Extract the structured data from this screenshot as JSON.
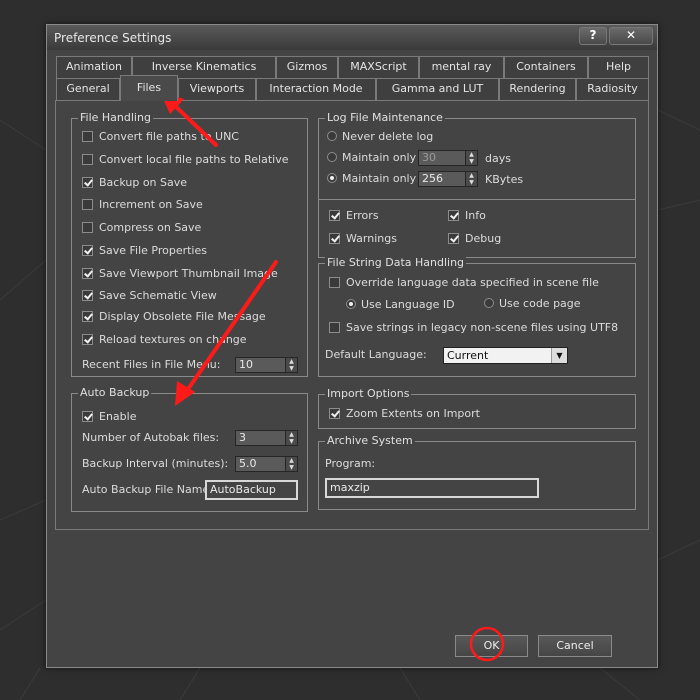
{
  "dialog": {
    "title": "Preference Settings",
    "help_label": "?",
    "close_label": "✕"
  },
  "tabs_row1": [
    "Animation",
    "Inverse Kinematics",
    "Gizmos",
    "MAXScript",
    "mental ray",
    "Containers",
    "Help"
  ],
  "tabs_row2": [
    "General",
    "Files",
    "Viewports",
    "Interaction Mode",
    "Gamma and LUT",
    "Rendering",
    "Radiosity"
  ],
  "active_tab": "Files",
  "file_handling": {
    "title": "File Handling",
    "items": [
      {
        "label": "Convert file paths to UNC",
        "checked": false
      },
      {
        "label": "Convert local file paths to Relative",
        "checked": false
      },
      {
        "label": "Backup on Save",
        "checked": true
      },
      {
        "label": "Increment on Save",
        "checked": false
      },
      {
        "label": "Compress on Save",
        "checked": false
      },
      {
        "label": "Save File Properties",
        "checked": true
      },
      {
        "label": "Save Viewport Thumbnail Image",
        "checked": true
      },
      {
        "label": "Save Schematic View",
        "checked": true
      },
      {
        "label": "Display Obsolete File Message",
        "checked": true
      },
      {
        "label": "Reload textures on change",
        "checked": true
      }
    ],
    "recent_label": "Recent Files in File Menu:",
    "recent_value": "10"
  },
  "auto_backup": {
    "title": "Auto Backup",
    "enable_label": "Enable",
    "enable_checked": true,
    "num_label": "Number of Autobak files:",
    "num_value": "3",
    "interval_label": "Backup Interval (minutes):",
    "interval_value": "5.0",
    "name_label": "Auto Backup File Name:",
    "name_value": "AutoBackup"
  },
  "log": {
    "title": "Log File Maintenance",
    "never_label": "Never delete log",
    "days_radio_label": "Maintain only",
    "days_value": "30",
    "days_unit": "days",
    "kb_radio_label": "Maintain only",
    "kb_value": "256",
    "kb_unit": "KBytes",
    "errors_label": "Errors",
    "info_label": "Info",
    "warnings_label": "Warnings",
    "debug_label": "Debug"
  },
  "file_string": {
    "title": "File String Data Handling",
    "override_label": "Override language data specified in scene file",
    "use_lang_label": "Use Language ID",
    "use_code_label": "Use code page",
    "save_strings_label": "Save strings in legacy non-scene files using UTF8",
    "default_lang_label": "Default Language:",
    "default_lang_value": "Current"
  },
  "import": {
    "title": "Import Options",
    "zoom_label": "Zoom Extents on Import"
  },
  "archive": {
    "title": "Archive System",
    "program_label": "Program:",
    "program_value": "maxzip"
  },
  "footer": {
    "ok_label": "OK",
    "cancel_label": "Cancel"
  },
  "colors": {
    "annotation": "#ff1a1a",
    "dialog_bg": "#444444"
  }
}
